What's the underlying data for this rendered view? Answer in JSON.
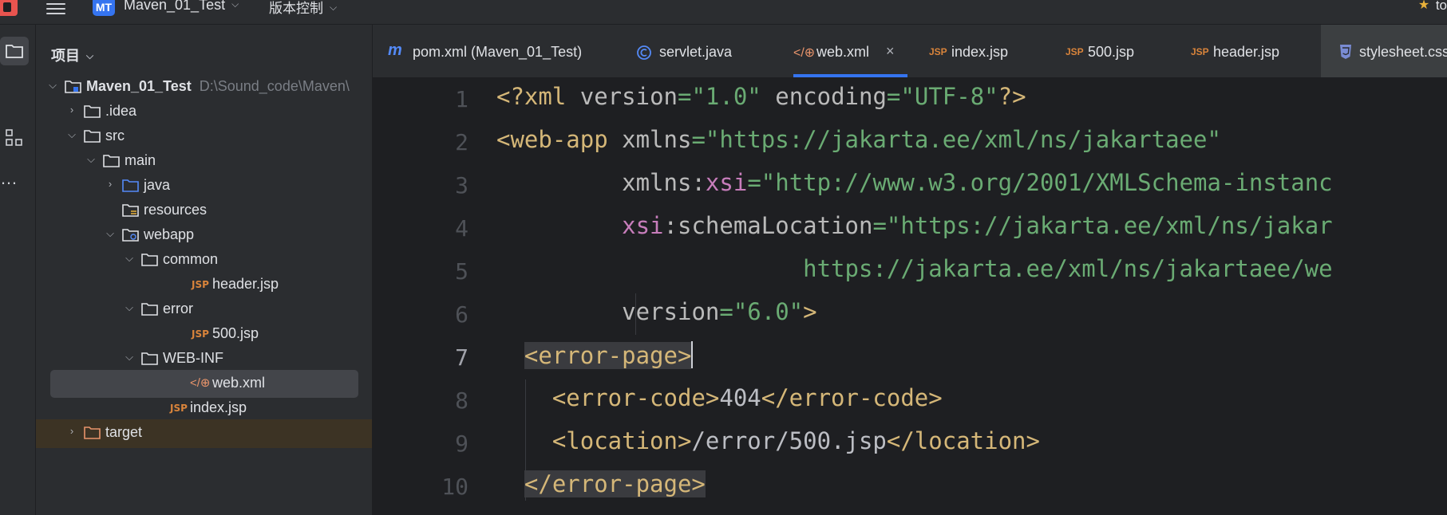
{
  "titlebar": {
    "project_badge": "MT",
    "project_name": "Maven_01_Test",
    "vcs_label": "版本控制",
    "right_text": "to"
  },
  "project_panel": {
    "title": "项目",
    "tree": [
      {
        "label": "Maven_01_Test",
        "hint": "D:\\Sound_code\\Maven\\",
        "type": "module",
        "expanded": true
      },
      {
        "label": ".idea",
        "type": "folder",
        "expanded": false
      },
      {
        "label": "src",
        "type": "folder",
        "expanded": true
      },
      {
        "label": "main",
        "type": "folder",
        "expanded": true
      },
      {
        "label": "java",
        "type": "source-folder",
        "expanded": false
      },
      {
        "label": "resources",
        "type": "resources-folder"
      },
      {
        "label": "webapp",
        "type": "web-folder",
        "expanded": true
      },
      {
        "label": "common",
        "type": "folder",
        "expanded": true
      },
      {
        "label": "header.jsp",
        "type": "jsp"
      },
      {
        "label": "error",
        "type": "folder",
        "expanded": true
      },
      {
        "label": "500.jsp",
        "type": "jsp"
      },
      {
        "label": "WEB-INF",
        "type": "folder",
        "expanded": true
      },
      {
        "label": "web.xml",
        "type": "xml",
        "selected": true
      },
      {
        "label": "index.jsp",
        "type": "jsp"
      },
      {
        "label": "target",
        "type": "excluded-folder",
        "expanded": false
      }
    ]
  },
  "tabs": [
    {
      "label": "pom.xml (Maven_01_Test)",
      "icon": "maven-icon"
    },
    {
      "label": "servlet.java",
      "icon": "class-icon"
    },
    {
      "label": "web.xml",
      "icon": "xml-icon",
      "active": true
    },
    {
      "label": "index.jsp",
      "icon": "jsp-icon"
    },
    {
      "label": "500.jsp",
      "icon": "jsp-icon"
    },
    {
      "label": "header.jsp",
      "icon": "jsp-icon"
    },
    {
      "label": "stylesheet.css",
      "icon": "css-icon"
    }
  ],
  "editor": {
    "line_numbers": [
      "1",
      "2",
      "3",
      "4",
      "5",
      "6",
      "7",
      "8",
      "9",
      "10"
    ],
    "current_line": 7,
    "lines": {
      "l1": {
        "a": "<?xml ",
        "b": "version",
        "c": "=",
        "d": "\"1.0\"",
        "e": " ",
        "f": "encoding",
        "g": "=",
        "h": "\"UTF-8\"",
        "i": "?>"
      },
      "l2": {
        "a": "<web-app ",
        "b": "xmlns",
        "c": "=",
        "d": "\"https://jakarta.ee/xml/ns/jakartaee\""
      },
      "l3": {
        "a": "xmlns",
        "b": ":",
        "c": "xsi",
        "d": "=",
        "e": "\"http://www.w3.org/2001/XMLSchema-instanc"
      },
      "l4": {
        "a": "xsi",
        "b": ":schemaLocation",
        "c": "=",
        "d": "\"https://jakarta.ee/xml/ns/jakar"
      },
      "l5": {
        "a": "https://jakarta.ee/xml/ns/jakartaee/we"
      },
      "l6": {
        "a": "version",
        "b": "=",
        "c": "\"6.0\"",
        "d": ">"
      },
      "l7": {
        "a": "<error-page>"
      },
      "l8": {
        "a": "<error-code>",
        "b": "404",
        "c": "</error-code>"
      },
      "l9": {
        "a": "<location>",
        "b": "/error/500.jsp",
        "c": "</location>"
      },
      "l10": {
        "a": "</error-page>"
      }
    }
  }
}
